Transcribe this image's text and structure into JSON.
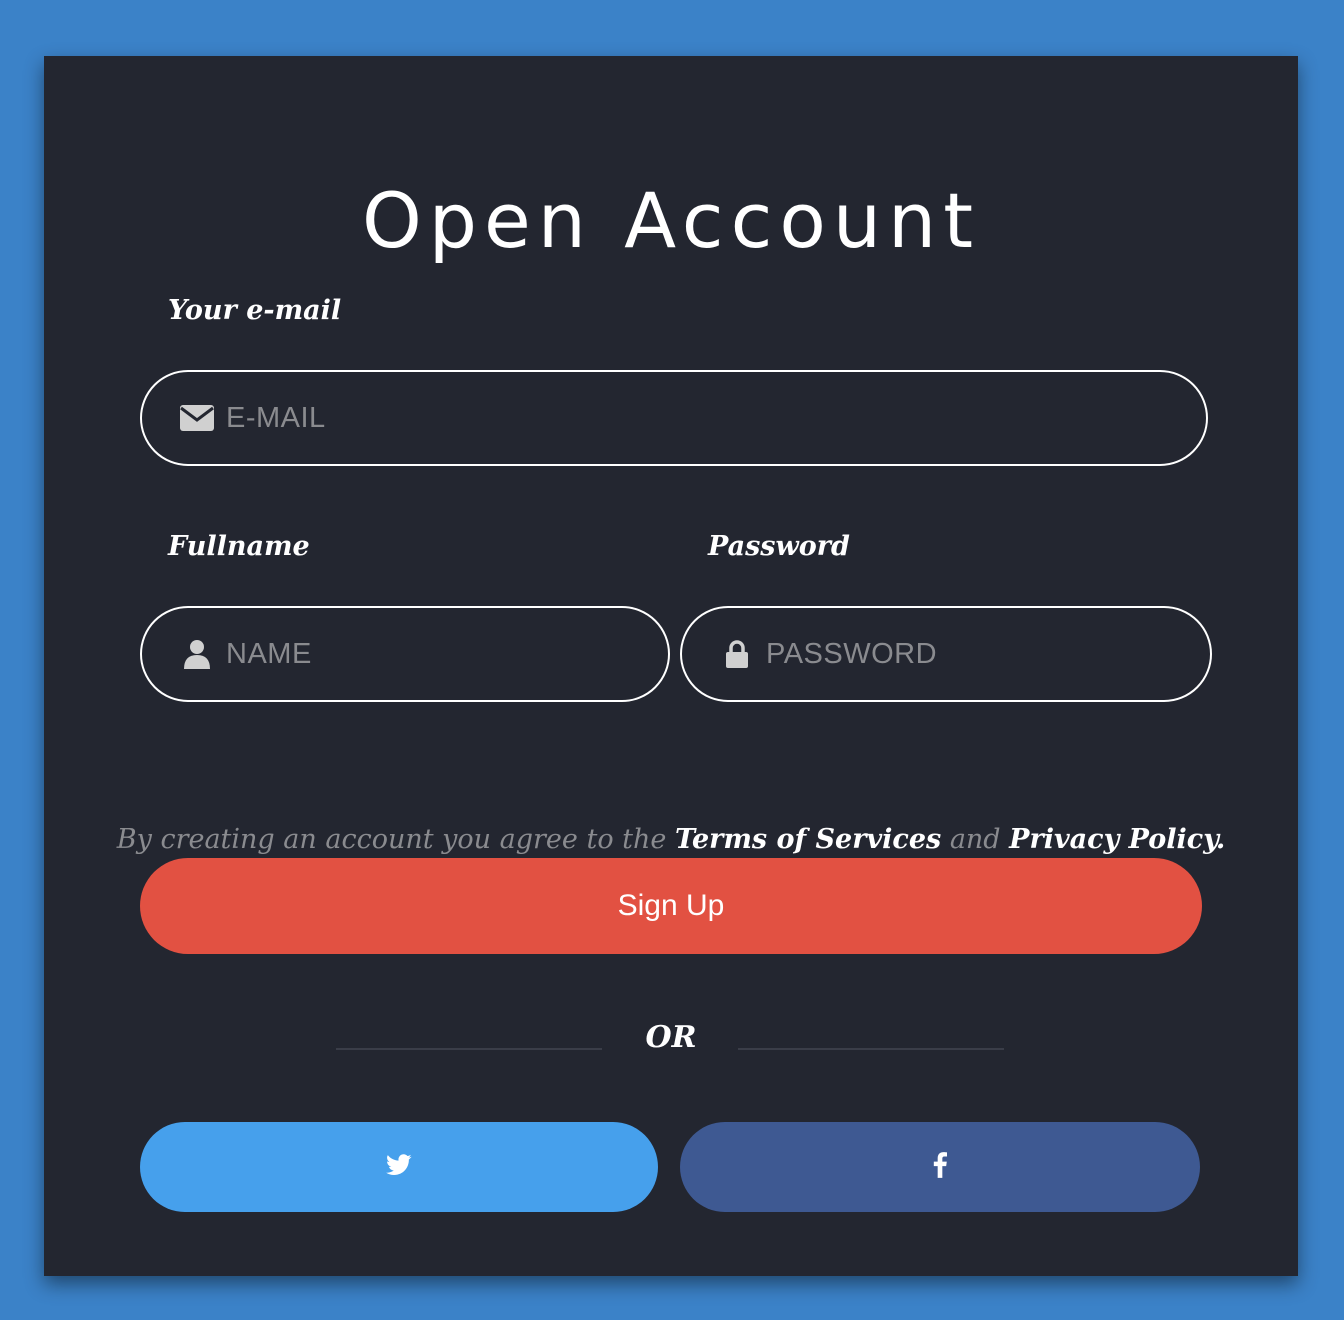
{
  "form": {
    "title": "Open Account",
    "email": {
      "label": "Your e-mail",
      "placeholder": "E-MAIL",
      "icon": "envelope-icon"
    },
    "fullname": {
      "label": "Fullname",
      "placeholder": "NAME",
      "icon": "user-icon"
    },
    "password": {
      "label": "Password",
      "placeholder": "PASSWORD",
      "icon": "lock-icon"
    },
    "agreement": {
      "prefix": "By creating an account you agree to the ",
      "terms_link": "Terms of Services",
      "middle": " and ",
      "privacy_link": "Privacy Policy",
      "suffix": "."
    },
    "signup_label": "Sign Up",
    "or_label": "OR",
    "social": {
      "twitter_icon": "twitter-icon",
      "facebook_icon": "facebook-icon"
    }
  },
  "colors": {
    "page_background": "#3b82c8",
    "card_background": "#232630",
    "signup_button": "#e25142",
    "twitter_button": "#46a0ec",
    "facebook_button": "#3e5992",
    "placeholder_text": "#8a8b8f"
  }
}
